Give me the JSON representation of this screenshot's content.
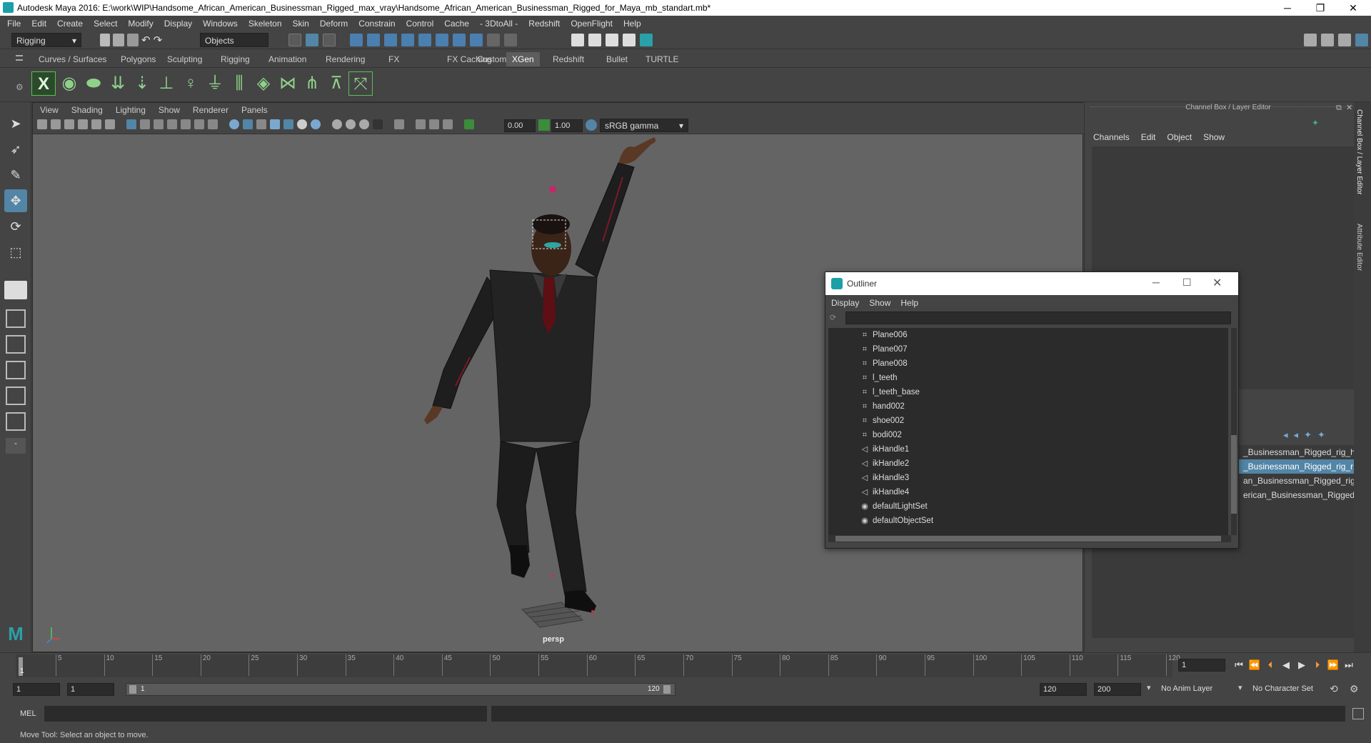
{
  "window": {
    "title": "Autodesk Maya 2016: E:\\work\\WIP\\Handsome_African_American_Businessman_Rigged_max_vray\\Handsome_African_American_Businessman_Rigged_for_Maya_mb_standart.mb*",
    "minimize": "─",
    "restore": "❐",
    "close": "✕"
  },
  "menubar": [
    "File",
    "Edit",
    "Create",
    "Select",
    "Modify",
    "Display",
    "Windows",
    "Skeleton",
    "Skin",
    "Deform",
    "Constrain",
    "Control",
    "Cache",
    "- 3DtoAll -",
    "Redshift",
    "OpenFlight",
    "Help"
  ],
  "status": {
    "menu_set": "Rigging",
    "selection_mode": "Objects"
  },
  "shelf_tabs": [
    "Curves / Surfaces",
    "Polygons",
    "Sculpting",
    "Rigging",
    "Animation",
    "Rendering",
    "FX",
    "FX Caching",
    "Custom",
    "XGen",
    "Redshift",
    "Bullet",
    "TURTLE"
  ],
  "shelf_active": "XGen",
  "viewport": {
    "menu": [
      "View",
      "Shading",
      "Lighting",
      "Show",
      "Renderer",
      "Panels"
    ],
    "exposure": "0.00",
    "gamma": "1.00",
    "color_space": "sRGB gamma",
    "camera": "persp"
  },
  "channel_box": {
    "title": "Channel Box / Layer Editor",
    "menu": [
      "Channels",
      "Edit",
      "Object",
      "Show"
    ],
    "side_tabs": [
      "Channel Box / Layer Editor",
      "Attribute Editor"
    ],
    "layers": [
      "_Businessman_Rigged_rig_h",
      "_Businessman_Rigged_rig_r",
      "an_Businessman_Rigged_rig",
      "erican_Businessman_Rigged"
    ],
    "selected_layer": 1
  },
  "outliner": {
    "title": "Outliner",
    "menu": [
      "Display",
      "Show",
      "Help"
    ],
    "items": [
      {
        "label": "Plane006",
        "icon": "mesh"
      },
      {
        "label": "Plane007",
        "icon": "mesh"
      },
      {
        "label": "Plane008",
        "icon": "mesh"
      },
      {
        "label": "l_teeth",
        "icon": "mesh"
      },
      {
        "label": "l_teeth_base",
        "icon": "mesh"
      },
      {
        "label": "hand002",
        "icon": "mesh"
      },
      {
        "label": "shoe002",
        "icon": "mesh"
      },
      {
        "label": "bodi002",
        "icon": "mesh"
      },
      {
        "label": "ikHandle1",
        "icon": "ik"
      },
      {
        "label": "ikHandle2",
        "icon": "ik"
      },
      {
        "label": "ikHandle3",
        "icon": "ik"
      },
      {
        "label": "ikHandle4",
        "icon": "ik"
      },
      {
        "label": "defaultLightSet",
        "icon": "set"
      },
      {
        "label": "defaultObjectSet",
        "icon": "set"
      }
    ]
  },
  "timeline": {
    "ticks": [
      "5",
      "10",
      "15",
      "20",
      "25",
      "30",
      "35",
      "40",
      "45",
      "50",
      "55",
      "60",
      "65",
      "70",
      "75",
      "80",
      "85",
      "90",
      "95",
      "100",
      "105",
      "110",
      "115",
      "120"
    ],
    "current_frame": "1",
    "frame_field": "1"
  },
  "range": {
    "start": "1",
    "playback_start": "1",
    "slider_start": "1",
    "slider_end": "120",
    "playback_end": "120",
    "end": "200",
    "anim_layer": "No Anim Layer",
    "character_set": "No Character Set"
  },
  "cmdline": {
    "label": "MEL"
  },
  "helpline": "Move Tool: Select an object to move."
}
